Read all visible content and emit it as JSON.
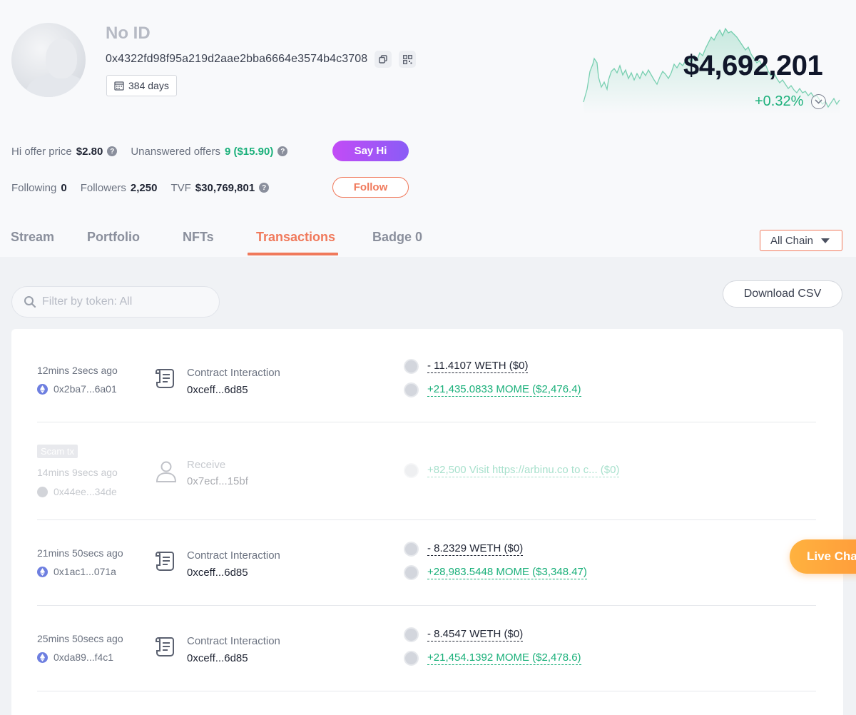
{
  "profile": {
    "name": "No ID",
    "address": "0x4322fd98f95a219d2aae2bba6664e3574b4c3708",
    "days": "384 days",
    "net_worth": "$4,692,201",
    "net_change": "+0.32%"
  },
  "stats": {
    "hi_offer_label": "Hi offer price",
    "hi_offer_value": "$2.80",
    "unanswered_label": "Unanswered offers",
    "unanswered_value": "9 ($15.90)",
    "following_label": "Following",
    "following_value": "0",
    "followers_label": "Followers",
    "followers_value": "2,250",
    "tvf_label": "TVF",
    "tvf_value": "$30,769,801"
  },
  "buttons": {
    "say_hi": "Say Hi",
    "follow": "Follow",
    "download_csv": "Download CSV",
    "live_chat": "Live Chat"
  },
  "tabs": [
    {
      "label": "Stream"
    },
    {
      "label": "Portfolio"
    },
    {
      "label": "NFTs"
    },
    {
      "label": "Transactions"
    },
    {
      "label": "Badge 0"
    }
  ],
  "chain_select": {
    "value": "All Chain"
  },
  "filter": {
    "placeholder": "Filter by token: All"
  },
  "transactions": [
    {
      "time": "12mins 2secs ago",
      "hash": "0x2ba7...6a01",
      "type": "Contract Interaction",
      "address": "0xceff...6d85",
      "amounts": [
        "- 11.4107 WETH ($0)",
        "+21,435.0833 MOME ($2,476.4)"
      ]
    },
    {
      "badge": "Scam tx",
      "time": "14mins 9secs ago",
      "hash": "0x44ee...34de",
      "type": "Receive",
      "address": "0x7ecf...15bf",
      "amounts": [
        "+82,500 Visit https://arbinu.co to c... ($0)"
      ]
    },
    {
      "time": "21mins 50secs ago",
      "hash": "0x1ac1...071a",
      "type": "Contract Interaction",
      "address": "0xceff...6d85",
      "amounts": [
        "- 8.2329 WETH ($0)",
        "+28,983.5448 MOME ($3,348.47)"
      ]
    },
    {
      "time": "25mins 50secs ago",
      "hash": "0xda89...f4c1",
      "type": "Contract Interaction",
      "address": "0xceff...6d85",
      "amounts": [
        "- 8.4547 WETH ($0)",
        "+21,454.1392 MOME ($2,478.6)"
      ]
    }
  ],
  "colors": {
    "accent": "#f0795b",
    "positive": "#1ab07a",
    "sayhi_gradient": [
      "#c24cf6",
      "#8a5cf6"
    ],
    "live_chat": "#ff9b3a"
  },
  "icons": {
    "copy": "copy-icon",
    "qr": "qr-code-icon",
    "calendar": "calendar-icon",
    "help": "question-icon",
    "search": "search-icon",
    "contract": "scroll-icon",
    "receive": "user-icon",
    "chain": "ethereum-icon",
    "caret": "caret-down-icon",
    "expand": "chevron-down-icon"
  }
}
